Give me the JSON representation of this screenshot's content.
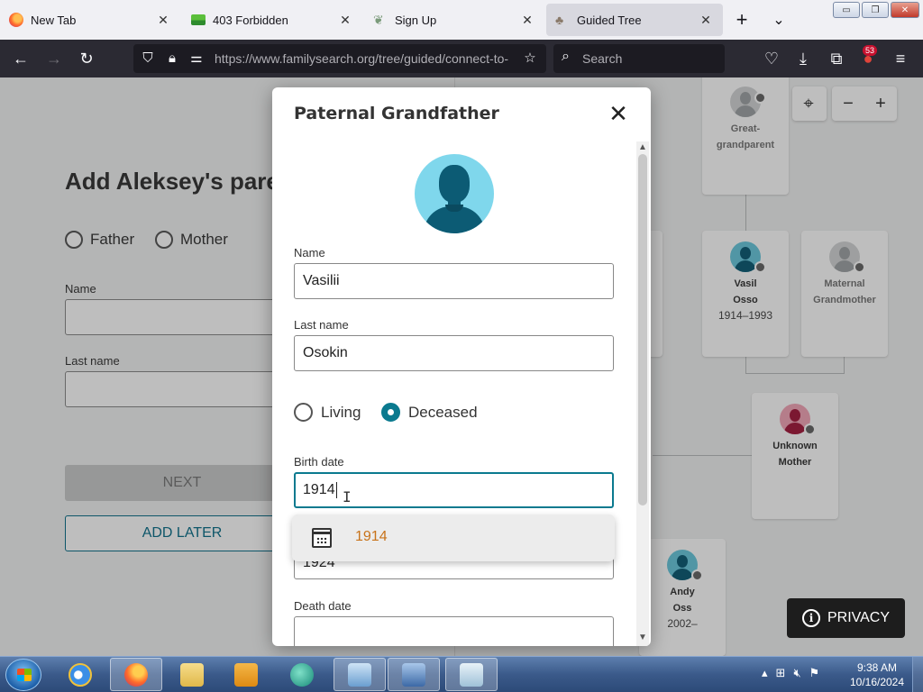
{
  "browser": {
    "tabs": [
      {
        "title": "New Tab",
        "icon": "firefox-icon",
        "active": false
      },
      {
        "title": "403 Forbidden",
        "icon": "image-icon",
        "active": false
      },
      {
        "title": "Sign Up",
        "icon": "leaf-icon",
        "active": false
      },
      {
        "title": "Guided Tree",
        "icon": "tree-icon",
        "active": true
      }
    ],
    "url": "https://www.familysearch.org/tree/guided/connect-to-",
    "search_placeholder": "Search",
    "extension_badge": "53"
  },
  "left_panel": {
    "heading": "Add Aleksey's pare",
    "radio_father": "Father",
    "radio_mother": "Mother",
    "name_label": "Name",
    "last_name_label": "Last name",
    "next_button": "NEXT",
    "add_later_button": "ADD LATER"
  },
  "tree": {
    "cards": [
      {
        "name1": "Great-",
        "name2": "grandparent",
        "dates": ""
      },
      {
        "name1": "Vasil",
        "name2": "Osso",
        "dates": "1914–1993"
      },
      {
        "name1": "Maternal",
        "name2": "Grandmother",
        "dates": ""
      },
      {
        "name1": "Unknown",
        "name2": "Mother",
        "dates": ""
      },
      {
        "name1": "Andy",
        "name2": "Oss",
        "dates": "2002–"
      }
    ],
    "privacy_label": "PRIVACY"
  },
  "modal": {
    "title": "Paternal Grandfather",
    "name_label": "Name",
    "name_value": "Vasilii",
    "last_name_label": "Last name",
    "last_name_value": "Osokin",
    "status_options": [
      "Living",
      "Deceased"
    ],
    "status_selected": "Deceased",
    "birth_date_label": "Birth date",
    "birth_date_value": "1914",
    "suggestion": "1914",
    "hidden_field_value": "1924",
    "death_date_label": "Death date",
    "death_date_value": ""
  },
  "taskbar": {
    "time": "9:38 AM",
    "date": "10/16/2024"
  },
  "colors": {
    "accent_teal": "#0b7a8f",
    "suggestion_orange": "#c8731a",
    "browser_dark": "#2b2a33"
  }
}
